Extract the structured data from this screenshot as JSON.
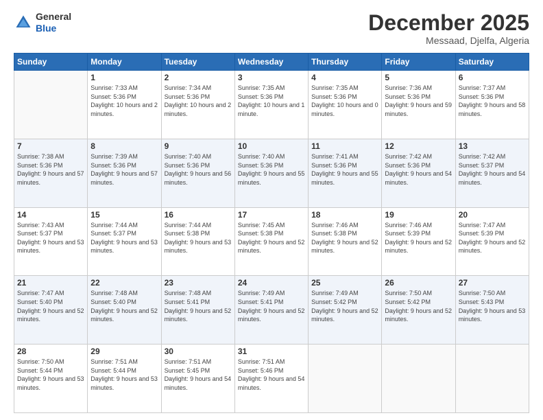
{
  "header": {
    "logo_general": "General",
    "logo_blue": "Blue",
    "month_title": "December 2025",
    "subtitle": "Messaad, Djelfa, Algeria"
  },
  "days_of_week": [
    "Sunday",
    "Monday",
    "Tuesday",
    "Wednesday",
    "Thursday",
    "Friday",
    "Saturday"
  ],
  "weeks": [
    [
      {
        "day": "",
        "empty": true
      },
      {
        "day": "1",
        "sunrise": "7:33 AM",
        "sunset": "5:36 PM",
        "daylight": "10 hours and 2 minutes."
      },
      {
        "day": "2",
        "sunrise": "7:34 AM",
        "sunset": "5:36 PM",
        "daylight": "10 hours and 2 minutes."
      },
      {
        "day": "3",
        "sunrise": "7:35 AM",
        "sunset": "5:36 PM",
        "daylight": "10 hours and 1 minute."
      },
      {
        "day": "4",
        "sunrise": "7:35 AM",
        "sunset": "5:36 PM",
        "daylight": "10 hours and 0 minutes."
      },
      {
        "day": "5",
        "sunrise": "7:36 AM",
        "sunset": "5:36 PM",
        "daylight": "9 hours and 59 minutes."
      },
      {
        "day": "6",
        "sunrise": "7:37 AM",
        "sunset": "5:36 PM",
        "daylight": "9 hours and 58 minutes."
      }
    ],
    [
      {
        "day": "7",
        "sunrise": "7:38 AM",
        "sunset": "5:36 PM",
        "daylight": "9 hours and 57 minutes."
      },
      {
        "day": "8",
        "sunrise": "7:39 AM",
        "sunset": "5:36 PM",
        "daylight": "9 hours and 57 minutes."
      },
      {
        "day": "9",
        "sunrise": "7:40 AM",
        "sunset": "5:36 PM",
        "daylight": "9 hours and 56 minutes."
      },
      {
        "day": "10",
        "sunrise": "7:40 AM",
        "sunset": "5:36 PM",
        "daylight": "9 hours and 55 minutes."
      },
      {
        "day": "11",
        "sunrise": "7:41 AM",
        "sunset": "5:36 PM",
        "daylight": "9 hours and 55 minutes."
      },
      {
        "day": "12",
        "sunrise": "7:42 AM",
        "sunset": "5:36 PM",
        "daylight": "9 hours and 54 minutes."
      },
      {
        "day": "13",
        "sunrise": "7:42 AM",
        "sunset": "5:37 PM",
        "daylight": "9 hours and 54 minutes."
      }
    ],
    [
      {
        "day": "14",
        "sunrise": "7:43 AM",
        "sunset": "5:37 PM",
        "daylight": "9 hours and 53 minutes."
      },
      {
        "day": "15",
        "sunrise": "7:44 AM",
        "sunset": "5:37 PM",
        "daylight": "9 hours and 53 minutes."
      },
      {
        "day": "16",
        "sunrise": "7:44 AM",
        "sunset": "5:38 PM",
        "daylight": "9 hours and 53 minutes."
      },
      {
        "day": "17",
        "sunrise": "7:45 AM",
        "sunset": "5:38 PM",
        "daylight": "9 hours and 52 minutes."
      },
      {
        "day": "18",
        "sunrise": "7:46 AM",
        "sunset": "5:38 PM",
        "daylight": "9 hours and 52 minutes."
      },
      {
        "day": "19",
        "sunrise": "7:46 AM",
        "sunset": "5:39 PM",
        "daylight": "9 hours and 52 minutes."
      },
      {
        "day": "20",
        "sunrise": "7:47 AM",
        "sunset": "5:39 PM",
        "daylight": "9 hours and 52 minutes."
      }
    ],
    [
      {
        "day": "21",
        "sunrise": "7:47 AM",
        "sunset": "5:40 PM",
        "daylight": "9 hours and 52 minutes."
      },
      {
        "day": "22",
        "sunrise": "7:48 AM",
        "sunset": "5:40 PM",
        "daylight": "9 hours and 52 minutes."
      },
      {
        "day": "23",
        "sunrise": "7:48 AM",
        "sunset": "5:41 PM",
        "daylight": "9 hours and 52 minutes."
      },
      {
        "day": "24",
        "sunrise": "7:49 AM",
        "sunset": "5:41 PM",
        "daylight": "9 hours and 52 minutes."
      },
      {
        "day": "25",
        "sunrise": "7:49 AM",
        "sunset": "5:42 PM",
        "daylight": "9 hours and 52 minutes."
      },
      {
        "day": "26",
        "sunrise": "7:50 AM",
        "sunset": "5:42 PM",
        "daylight": "9 hours and 52 minutes."
      },
      {
        "day": "27",
        "sunrise": "7:50 AM",
        "sunset": "5:43 PM",
        "daylight": "9 hours and 53 minutes."
      }
    ],
    [
      {
        "day": "28",
        "sunrise": "7:50 AM",
        "sunset": "5:44 PM",
        "daylight": "9 hours and 53 minutes."
      },
      {
        "day": "29",
        "sunrise": "7:51 AM",
        "sunset": "5:44 PM",
        "daylight": "9 hours and 53 minutes."
      },
      {
        "day": "30",
        "sunrise": "7:51 AM",
        "sunset": "5:45 PM",
        "daylight": "9 hours and 54 minutes."
      },
      {
        "day": "31",
        "sunrise": "7:51 AM",
        "sunset": "5:46 PM",
        "daylight": "9 hours and 54 minutes."
      },
      {
        "day": "",
        "empty": true
      },
      {
        "day": "",
        "empty": true
      },
      {
        "day": "",
        "empty": true
      }
    ]
  ]
}
